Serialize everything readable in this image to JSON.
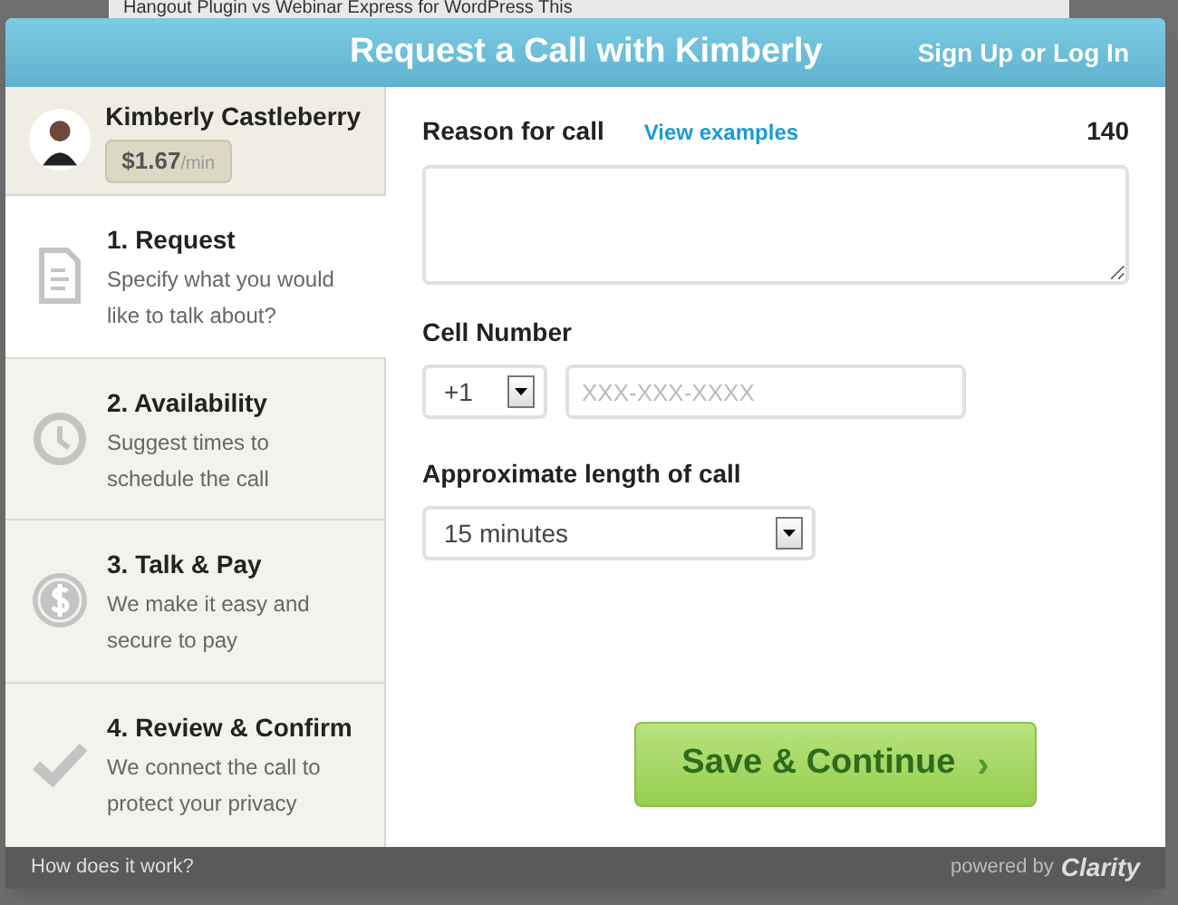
{
  "background_page": {
    "title": "Hangout  Plugin  vs  Webinar  Express  for  WordPress  This"
  },
  "dialog": {
    "title": "Request a Call with Kimberly",
    "auth_link": "Sign Up or Log In"
  },
  "expert": {
    "name": "Kimberly Castleberry",
    "price": "$1.67",
    "unit": "/min"
  },
  "steps": [
    {
      "kind": "document",
      "title": "1. Request",
      "description": "Specify what you would like to talk about?",
      "selected": true
    },
    {
      "kind": "clock",
      "title": "2. Availability",
      "description": "Suggest times to schedule the call",
      "selected": false
    },
    {
      "kind": "dollar",
      "title": "3. Talk & Pay",
      "description": "We make it easy and secure to pay",
      "selected": false
    },
    {
      "kind": "check",
      "title": "4. Review & Confirm",
      "description": "We connect the call to protect your privacy",
      "selected": false
    }
  ],
  "form": {
    "reason_label": "Reason for call",
    "examples_link": "View examples",
    "char_count": "140",
    "cell_label": "Cell Number",
    "country_code": "+1",
    "phone_placeholder": "XXX-XXX-XXXX",
    "length_label": "Approximate length of call",
    "length_value": "15 minutes",
    "submit": "Save & Continue",
    "submit_arrow": "›"
  },
  "footer": {
    "help_link": "How does it work?",
    "powered_by": "powered by",
    "brand": "Clarity"
  }
}
